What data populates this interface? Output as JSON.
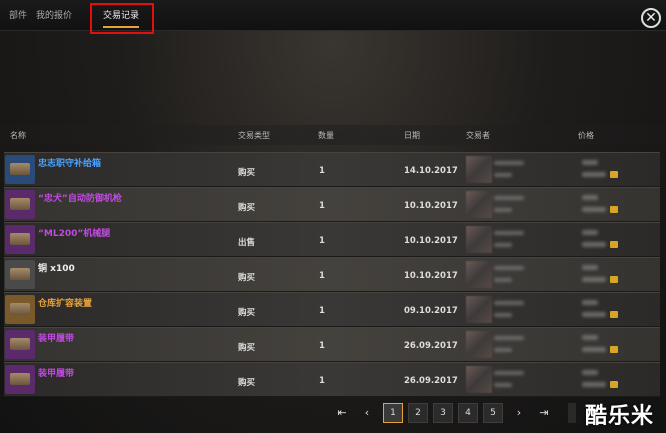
{
  "tabs": [
    {
      "label": "部件"
    },
    {
      "label": "我的报价"
    },
    {
      "label": "交易记录"
    }
  ],
  "close_icon": "close-icon",
  "columns": {
    "name": "名称",
    "type": "交易类型",
    "qty": "数量",
    "date": "日期",
    "trader": "交易者",
    "price": "价格"
  },
  "rows": [
    {
      "name": "忠志职守补给箱",
      "name_color": "#4aa0ff",
      "type": "购买",
      "qty": "1",
      "date": "14.10.2017",
      "thumb": "#2a4a7a"
    },
    {
      "name": "“忠犬”自动防御机枪",
      "name_color": "#c04ae0",
      "type": "购买",
      "qty": "1",
      "date": "10.10.2017",
      "thumb": "#5a2a6a"
    },
    {
      "name": "“ML200”机械腿",
      "name_color": "#c04ae0",
      "type": "出售",
      "qty": "1",
      "date": "10.10.2017",
      "thumb": "#5a2a6a"
    },
    {
      "name": "铜 x100",
      "name_color": "#eeeeee",
      "type": "购买",
      "qty": "1",
      "date": "10.10.2017",
      "thumb": "#4a4a4a"
    },
    {
      "name": "仓库扩容装置",
      "name_color": "#e8a23a",
      "type": "购买",
      "qty": "1",
      "date": "09.10.2017",
      "thumb": "#7a5a2a"
    },
    {
      "name": "装甲履带",
      "name_color": "#c04ae0",
      "type": "购买",
      "qty": "1",
      "date": "26.09.2017",
      "thumb": "#5a2a6a"
    },
    {
      "name": "装甲履带",
      "name_color": "#c04ae0",
      "type": "购买",
      "qty": "1",
      "date": "26.09.2017",
      "thumb": "#5a2a6a"
    }
  ],
  "pagination": {
    "first_icon": "first-page-icon",
    "prev_icon": "prev-page-icon",
    "pages": [
      "1",
      "2",
      "3",
      "4",
      "5"
    ],
    "current": "1",
    "next_icon": "next-page-icon",
    "last_icon": "last-page-icon"
  },
  "watermark": "酷乐米"
}
